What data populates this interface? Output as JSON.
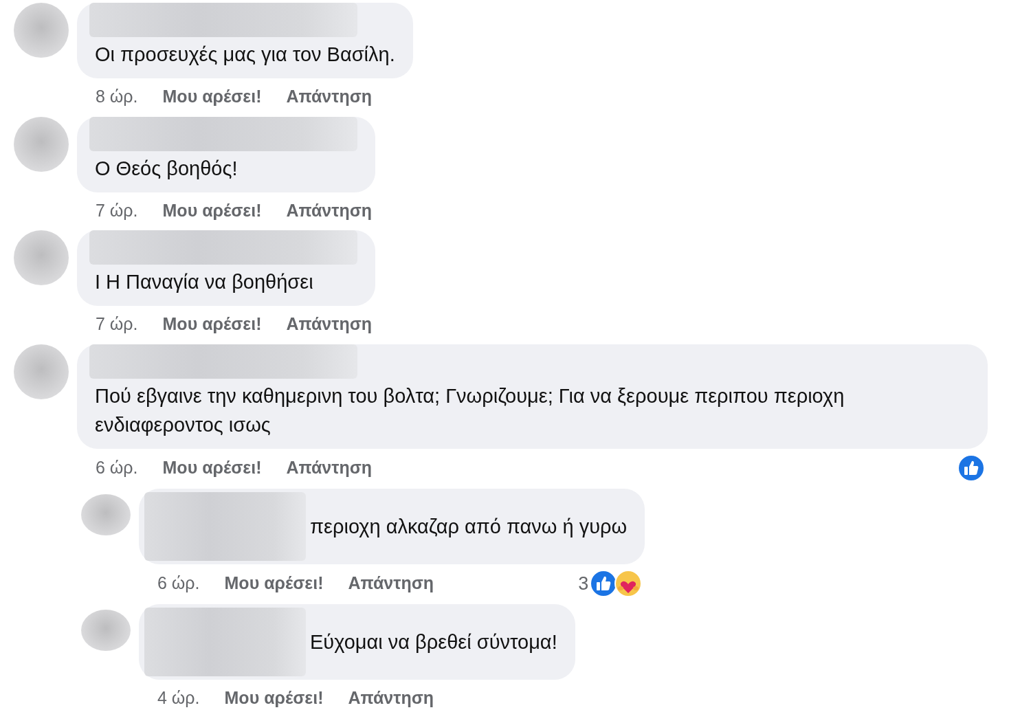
{
  "comments": [
    {
      "kind": "comment",
      "text": "Οι προσευχές μας για τον Βασίλη.",
      "time": "8 ώρ.",
      "like_label": "Μου αρέσει!",
      "reply_label": "Απάντηση"
    },
    {
      "kind": "comment",
      "text": "Ο Θεός βοηθός!",
      "time": "7 ώρ.",
      "like_label": "Μου αρέσει!",
      "reply_label": "Απάντηση"
    },
    {
      "kind": "comment",
      "text": "Ι Η Παναγία να βοηθήσει",
      "time": "7 ώρ.",
      "like_label": "Μου αρέσει!",
      "reply_label": "Απάντηση"
    },
    {
      "kind": "comment",
      "text": "Πού εβγαινε την καθημερινη του βολτα; Γνωριζουμε; Για να ξερουμε περιπου περιοχη ενδιαφεροντος ισως",
      "time": "6 ώρ.",
      "like_label": "Μου αρέσει!",
      "reply_label": "Απάντηση",
      "reactions": [
        {
          "kind": "like"
        }
      ]
    },
    {
      "kind": "reply",
      "text": "περιοχη αλκαζαρ από πανω ή γυρω",
      "time": "6 ώρ.",
      "like_label": "Μου αρέσει!",
      "reply_label": "Απάντηση",
      "reaction_count": "3",
      "reactions": [
        {
          "kind": "like"
        },
        {
          "kind": "care"
        }
      ]
    },
    {
      "kind": "reply",
      "text": "Εύχομαι να βρεθεί σύντομα!",
      "time": "4 ώρ.",
      "like_label": "Μου αρέσει!",
      "reply_label": "Απάντηση"
    }
  ]
}
